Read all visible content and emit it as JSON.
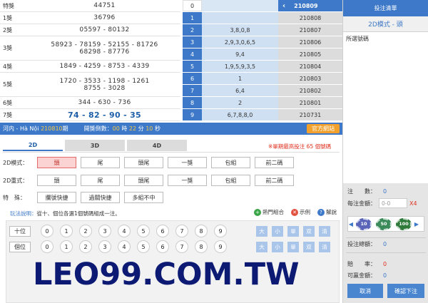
{
  "results": [
    {
      "prize": "特獎",
      "lines": [
        "44751"
      ]
    },
    {
      "prize": "1獎",
      "lines": [
        "36796"
      ]
    },
    {
      "prize": "2獎",
      "lines": [
        "05597 - 80132"
      ]
    },
    {
      "prize": "3獎",
      "lines": [
        "58923 - 78159 - 52155 - 81726",
        "68298 - 87776"
      ]
    },
    {
      "prize": "4獎",
      "lines": [
        "1849 - 4259 - 8753 - 4339"
      ]
    },
    {
      "prize": "5獎",
      "lines": [
        "1720 - 3533 - 1198 - 1261",
        "8755 - 3028"
      ]
    },
    {
      "prize": "6獎",
      "lines": [
        "344 - 630 - 736"
      ]
    },
    {
      "prize": "7獎",
      "lines": [
        "74 - 82 - 90 - 35"
      ]
    }
  ],
  "lotto": [
    {
      "idx": "0",
      "val": "",
      "period": "210809"
    },
    {
      "idx": "1",
      "val": "",
      "period": "210808"
    },
    {
      "idx": "2",
      "val": "3,8,0,8",
      "period": "210807"
    },
    {
      "idx": "3",
      "val": "2,9,3,0,6,5",
      "period": "210806"
    },
    {
      "idx": "4",
      "val": "9,4",
      "period": "210805"
    },
    {
      "idx": "5",
      "val": "1,9,5,9,3,5",
      "period": "210804"
    },
    {
      "idx": "6",
      "val": "1",
      "period": "210803"
    },
    {
      "idx": "7",
      "val": "6,4",
      "period": "210802"
    },
    {
      "idx": "8",
      "val": "2",
      "period": "210801"
    },
    {
      "idx": "9",
      "val": "6,7,8,8,0",
      "period": "210731"
    }
  ],
  "status": {
    "location": "河内 - Hà Nội",
    "period_num": "210810",
    "period_suffix": "期",
    "countdown_label": "開獎倒數：",
    "hours": "00",
    "hours_unit": "時",
    "minutes": "22",
    "minutes_unit": "分",
    "seconds": "10",
    "seconds_unit": "秒",
    "site_button": "官方網站"
  },
  "tabs": [
    "2D",
    "3D",
    "4D"
  ],
  "notice": "※單期最高投注 65 個號碼",
  "modes": {
    "row1_label": "2D模式：",
    "row1": [
      "頭",
      "尾",
      "頭尾",
      "一獎",
      "包組",
      "前二碼"
    ],
    "row2_label": "2D重式：",
    "row2": [
      "頭",
      "尾",
      "頭尾",
      "一獎",
      "包組",
      "前二碼"
    ],
    "row3_label": "特　殊：",
    "row3": [
      "攔號快捷",
      "過關快捷",
      "多組不中"
    ]
  },
  "help": {
    "prefix": "玩法說明：",
    "text": "從十、個位各選1個號碼組成一注。"
  },
  "links": [
    {
      "icon": "plus",
      "label": "熱門組合"
    },
    {
      "icon": "x",
      "label": "示例"
    },
    {
      "icon": "?",
      "label": "解說"
    }
  ],
  "digit_rows": [
    {
      "label": "十位",
      "balls": [
        "0",
        "1",
        "2",
        "3",
        "4",
        "5",
        "6",
        "7",
        "8",
        "9"
      ]
    },
    {
      "label": "個位",
      "balls": [
        "0",
        "1",
        "2",
        "3",
        "4",
        "5",
        "6",
        "7",
        "8",
        "9"
      ]
    }
  ],
  "quick": [
    "大",
    "小",
    "單",
    "双",
    "清"
  ],
  "watermark": "LEO99.COM.TW",
  "side": {
    "title": "投注清單",
    "mode": "2D模式 - 頭",
    "selected_label": "所選號碼",
    "count_label": "注　　數：",
    "count_value": "0",
    "amount_label": "每注金額：",
    "amount_placeholder": "0-0",
    "multiplier": "X4",
    "chips": [
      "10",
      "50",
      "100"
    ],
    "total_label": "投注總額：",
    "total_value": "0",
    "odds_label": "賠　　率：",
    "odds_value": "0",
    "win_label": "可贏金額：",
    "win_value": "0",
    "cancel": "取消",
    "confirm": "確認下注"
  },
  "colors": {
    "accent": "#3d79c8",
    "warn": "#f2a12c",
    "alert": "#e0301e",
    "highlight": "#f6c945"
  }
}
